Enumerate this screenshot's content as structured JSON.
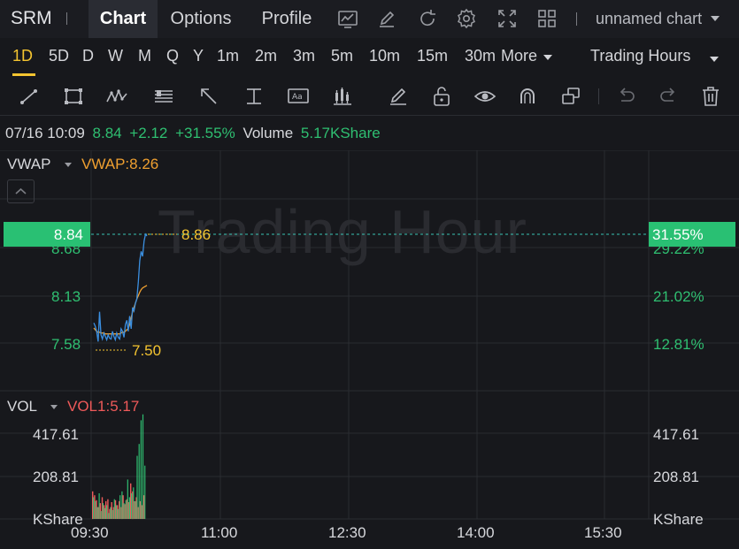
{
  "header": {
    "symbol": "SRM",
    "tabs": [
      {
        "label": "Chart",
        "active": true
      },
      {
        "label": "Options",
        "active": false
      },
      {
        "label": "Profile",
        "active": false
      }
    ],
    "icons": [
      "chart-snapshot-icon",
      "edit-icon",
      "refresh-icon",
      "settings-icon",
      "fullscreen-icon",
      "layout-grid-icon"
    ],
    "chart_name": "unnamed chart"
  },
  "intervals": {
    "items": [
      "1D",
      "5D",
      "D",
      "W",
      "M",
      "Q",
      "Y",
      "1m",
      "2m",
      "3m",
      "5m",
      "10m",
      "15m",
      "30m"
    ],
    "active": "1D",
    "more_label": "More",
    "session_label": "Trading Hours"
  },
  "tools": [
    "line-tool-icon",
    "rectangle-tool-icon",
    "pattern-tool-icon",
    "fib-tool-icon",
    "arrow-tool-icon",
    "text-position-tool-icon",
    "annotation-tool-icon",
    "indicator-tool-icon",
    "pencil-tool-icon",
    "unlock-icon",
    "eye-icon",
    "magnet-icon",
    "clone-icon",
    "undo-icon",
    "redo-icon",
    "trash-icon"
  ],
  "quote": {
    "datetime": "07/16 10:09",
    "price": "8.84",
    "change": "+2.12",
    "change_pct": "+31.55%",
    "volume_label": "Volume",
    "volume_value": "5.17KShare"
  },
  "main_pane": {
    "indicator": "VWAP",
    "indicator_value": "VWAP:8.26",
    "watermark": "Trading Hour",
    "price_badge": "8.84",
    "pct_badge": "31.55%",
    "left_axis": [
      "8.68",
      "8.13",
      "7.58"
    ],
    "right_axis": [
      "29.22%",
      "21.02%",
      "12.81%"
    ],
    "high_label": "8.86",
    "low_label": "7.50"
  },
  "volume_pane": {
    "indicator": "VOL",
    "indicator_value": "VOL1:5.17",
    "left_axis": [
      "417.61",
      "208.81",
      "KShare"
    ],
    "right_axis": [
      "417.61",
      "208.81",
      "KShare"
    ]
  },
  "time_axis": [
    "09:30",
    "11:00",
    "12:30",
    "14:00",
    "15:30"
  ],
  "colors": {
    "up": "#2fbf71",
    "down": "#ef5a5a",
    "price_line": "#3b8fe0",
    "vwap_line": "#f0a030",
    "accent": "#f4c430"
  },
  "chart_data": {
    "type": "line",
    "price_series": [
      7.82,
      7.78,
      7.72,
      7.6,
      7.95,
      7.68,
      7.63,
      7.7,
      7.66,
      7.62,
      7.68,
      7.64,
      7.63,
      7.72,
      7.66,
      7.62,
      7.7,
      7.65,
      7.63,
      7.75,
      7.72,
      7.65,
      7.8,
      7.85,
      7.72,
      7.9,
      7.75,
      8.0,
      7.96,
      8.05,
      8.1,
      8.3,
      8.55,
      8.66,
      8.6,
      8.78,
      8.86,
      8.84
    ],
    "vwap_series": [
      7.76,
      7.74,
      7.72,
      7.71,
      7.71,
      7.7,
      7.7,
      7.7,
      7.69,
      7.69,
      7.69,
      7.69,
      7.69,
      7.69,
      7.69,
      7.69,
      7.69,
      7.69,
      7.69,
      7.7,
      7.71,
      7.71,
      7.72,
      7.74,
      7.75,
      7.8,
      7.88,
      7.95,
      8.0,
      8.05,
      8.1,
      8.14,
      8.18,
      8.21,
      8.23,
      8.24,
      8.25,
      8.26
    ],
    "volume_up": [
      110,
      90,
      60,
      130,
      40,
      80,
      55,
      70,
      30,
      60,
      45,
      100,
      70,
      50,
      120,
      140,
      80,
      95,
      200,
      110,
      130,
      160,
      90,
      320,
      380,
      500,
      530,
      270
    ],
    "volume_down": [
      140,
      120,
      95,
      60,
      80,
      110,
      70,
      90,
      100,
      50,
      85,
      60,
      95,
      70,
      90,
      60,
      120,
      75,
      100,
      85,
      180,
      140,
      90,
      110,
      60,
      90,
      70,
      120
    ],
    "price_range": [
      7.3,
      9.1
    ],
    "volume_max": 560
  }
}
